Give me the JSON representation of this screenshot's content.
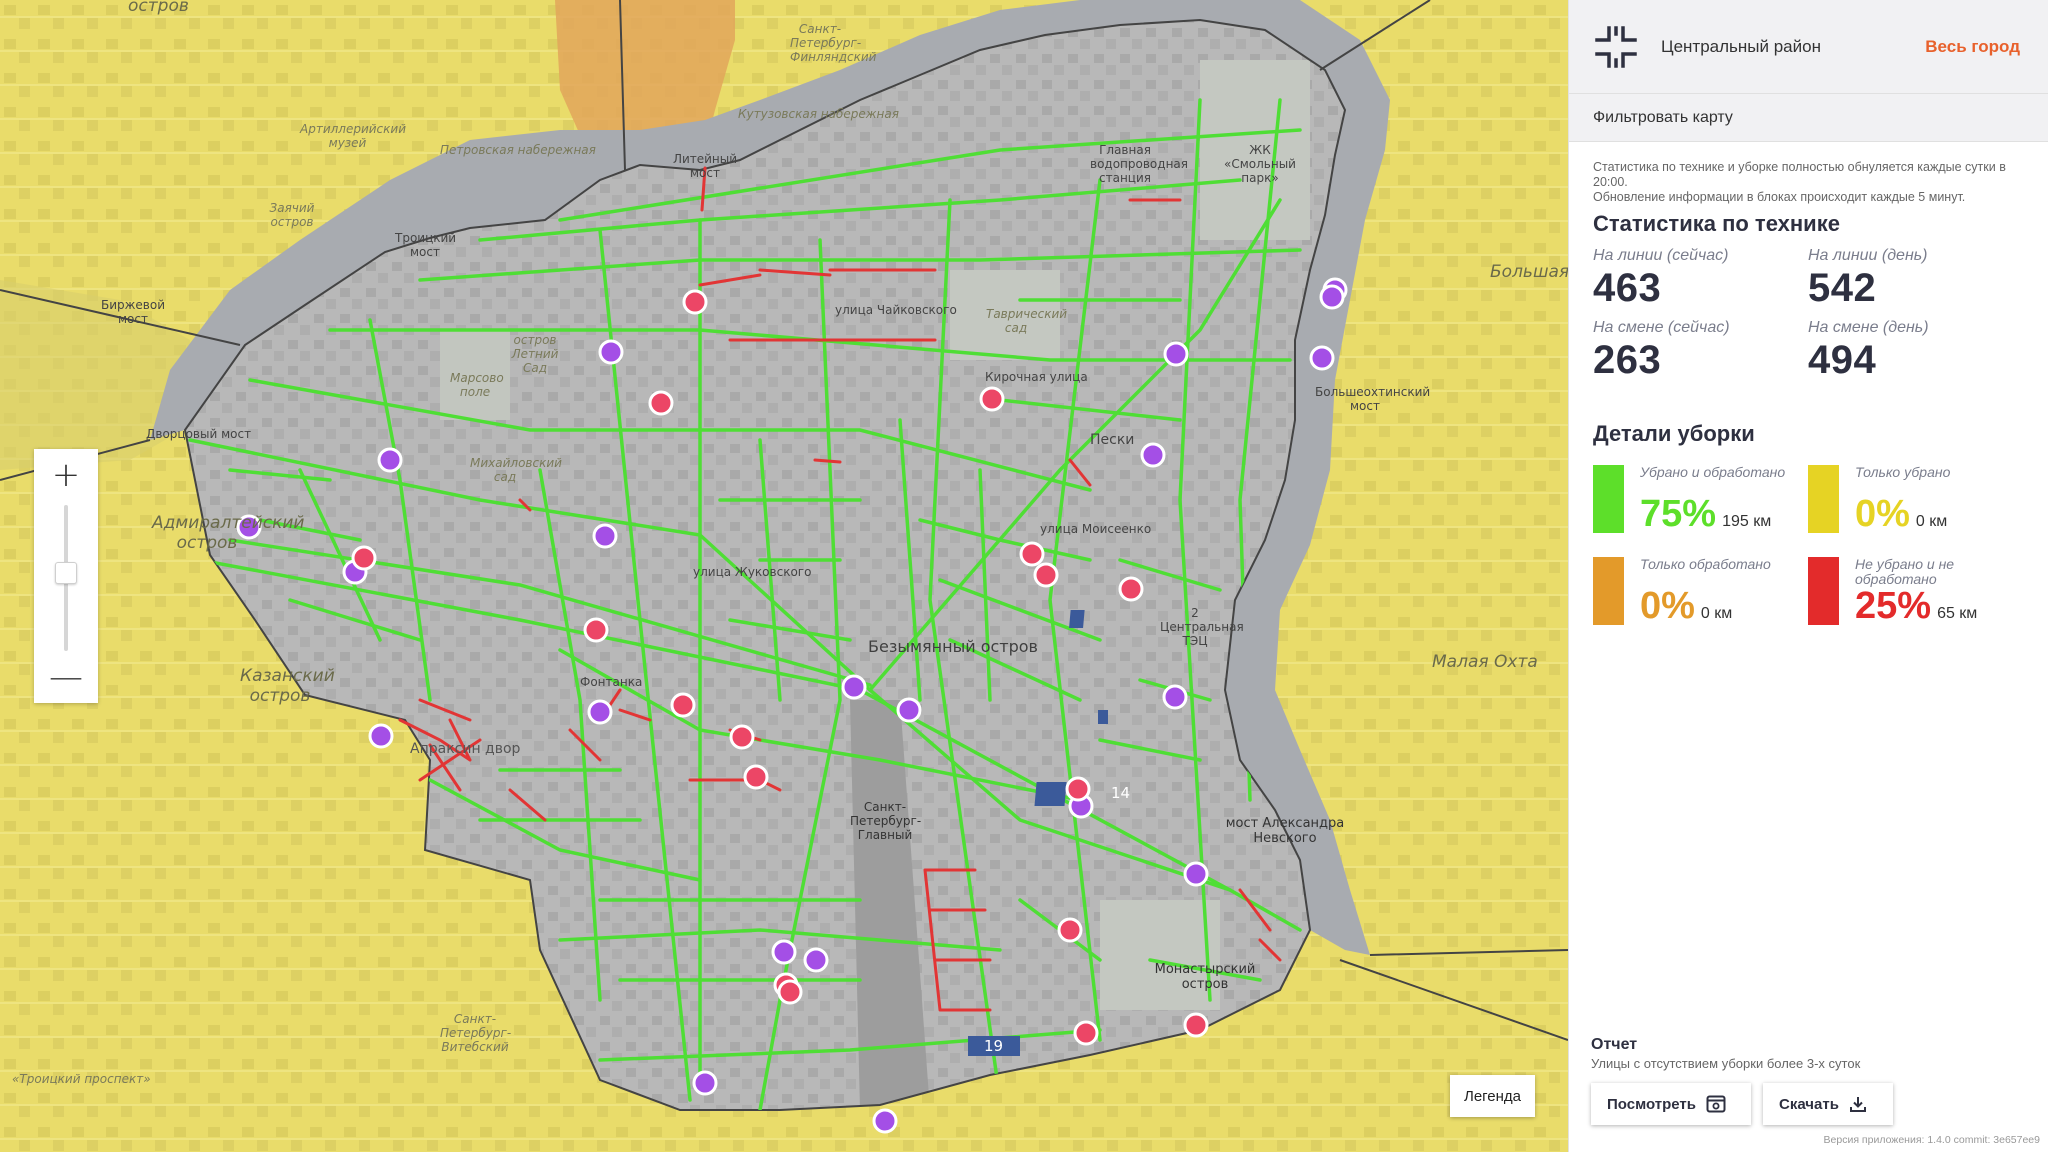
{
  "map": {
    "labels": {
      "ostrov_top": "остров",
      "spb_finlyandsky": "Санкт-Петербург-Финляндский",
      "kutuzov_emb": "Кутузовская набережная",
      "artillery_museum": "Артиллерийский музей",
      "petrovskaya_emb": "Петровская набережная",
      "liteyny_bridge": "Литейный мост",
      "main_water_station": "Главная водопроводная станция",
      "smolny_park": "ЖК «Смольный парк»",
      "zayachy_island": "Заячий остров",
      "troitsky_bridge": "Троицкий мост",
      "birzhevoy_bridge": "Биржевой мост",
      "dvortsovy_bridge": "Дворцовый мост",
      "summer_garden": "остров Летний Сад",
      "mars_field": "Марсово поле",
      "mikhailovsky_garden": "Михайловский сад",
      "tavrichesky_garden": "Таврический сад",
      "admiralteysky": "Адмиралтейский остров",
      "kazansky": "Казанский остров",
      "bezymyanny": "Безымянный остров",
      "spb_glavny": "Санкт-Петербург-Главный",
      "monastyrsky": "Монастырский остров",
      "alexander_nevsky_bridge": "мост Александра Невского",
      "bolsheokhtinsky_bridge": "Большеохтинский мост",
      "malaya_okhta": "Малая Охта",
      "peski": "Пески",
      "fontanka": "Фонтанка",
      "tchaikovsky_st": "улица Чайковского",
      "kirochnaya_st": "Кирочная улица",
      "zhukovsky_st": "улица Жуковского",
      "mayakovskaya": "улица Моисеенко",
      "vitebsky": "Санкт-Петербург-Витебский",
      "troitsky_pr": "«Троицкий проспект»",
      "sennoy": "Апраксин двор",
      "tec": "2 Центральная ТЭЦ",
      "bolshaya_ok": "Большая Ох"
    },
    "shields": [
      "14",
      "19"
    ],
    "zoom": {
      "in_label": "+",
      "out_label": "—"
    },
    "legend_label": "Легенда"
  },
  "sidebar": {
    "district": "Центральный район",
    "city_link": "Весь город",
    "filter_label": "Фильтровать карту",
    "info_line1": "Статистика по технике и уборке полностью обнуляется каждые сутки в 20:00.",
    "info_line2": "Обновление информации в блоках происходит каждые 5 минут.",
    "stats_title": "Статистика по технике",
    "stats": [
      {
        "label": "На линии (сейчас)",
        "value": "463"
      },
      {
        "label": "На линии (день)",
        "value": "542"
      },
      {
        "label": "На смене (сейчас)",
        "value": "263"
      },
      {
        "label": "На смене (день)",
        "value": "494"
      }
    ],
    "cleaning_title": "Детали уборки",
    "cleaning": [
      {
        "label": "Убрано и обработано",
        "pct": "75%",
        "km": "195 км",
        "color": "#5ddf2a"
      },
      {
        "label": "Только убрано",
        "pct": "0%",
        "km": "0 км",
        "color": "#e6d324"
      },
      {
        "label": "Только обработано",
        "pct": "0%",
        "km": "0 км",
        "color": "#e39a2a"
      },
      {
        "label": "Не убрано и не обработано",
        "pct": "25%",
        "km": "65 км",
        "color": "#e32b2b"
      }
    ],
    "report": {
      "title": "Отчет",
      "desc": "Улицы с отсутствием уборки более 3-х суток",
      "view_label": "Посмотреть",
      "download_label": "Скачать"
    },
    "version": "Версия приложения: 1.4.0 commit: 3e657ee9"
  }
}
